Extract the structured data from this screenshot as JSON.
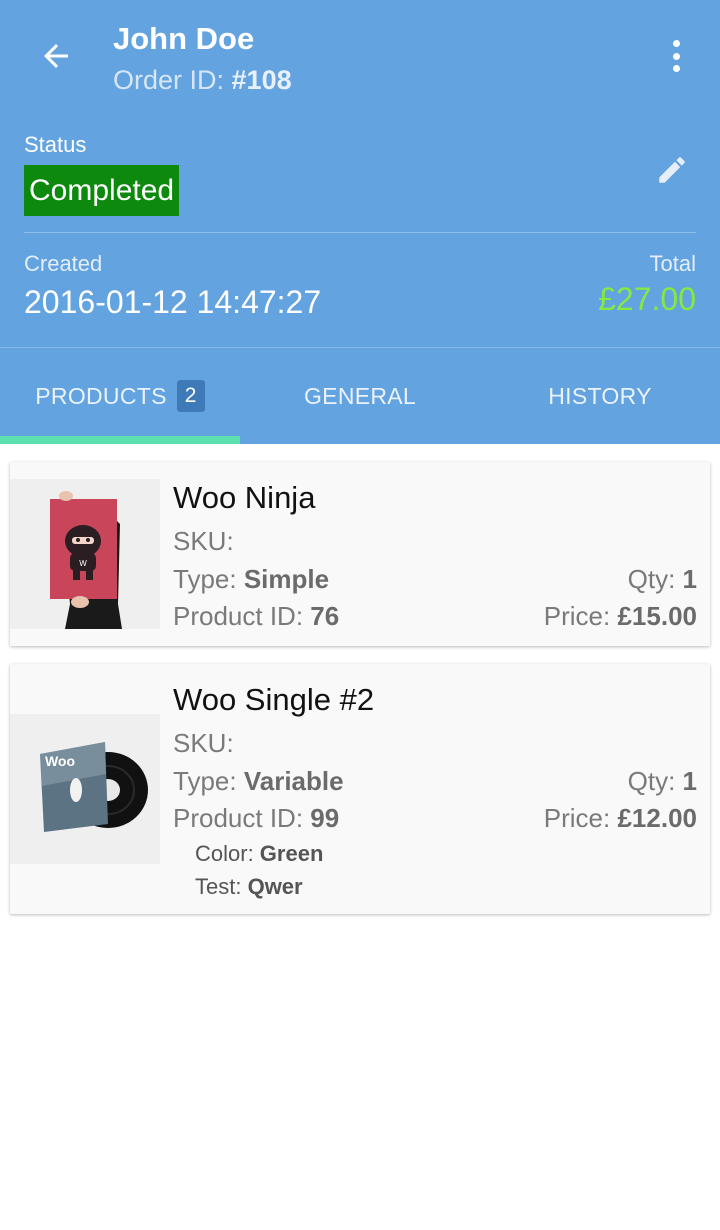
{
  "header": {
    "customer_name": "John Doe",
    "order_label": "Order ID: ",
    "order_id": "#108",
    "status_label": "Status",
    "status_value": "Completed",
    "created_label": "Created",
    "created_value": "2016-01-12 14:47:27",
    "total_label": "Total",
    "total_value": "£27.00"
  },
  "tabs": [
    {
      "label": "PRODUCTS",
      "badge": "2",
      "active": true
    },
    {
      "label": "GENERAL"
    },
    {
      "label": "HISTORY"
    }
  ],
  "products": [
    {
      "name": "Woo Ninja",
      "sku_label": "SKU:",
      "sku": "",
      "type_label": "Type: ",
      "type": "Simple",
      "qty_label": "Qty: ",
      "qty": "1",
      "id_label": "Product ID: ",
      "id": "76",
      "price_label": "Price: ",
      "price": "£15.00",
      "image_icon": "ninja-poster-image"
    },
    {
      "name": "Woo Single #2",
      "sku_label": "SKU:",
      "sku": "",
      "type_label": "Type: ",
      "type": "Variable",
      "qty_label": "Qty: ",
      "qty": "1",
      "id_label": "Product ID: ",
      "id": "99",
      "price_label": "Price: ",
      "price": "£12.00",
      "image_icon": "vinyl-record-image",
      "image_text": "Woo",
      "attributes": [
        {
          "label": "Color: ",
          "value": "Green"
        },
        {
          "label": "Test: ",
          "value": "Qwer"
        }
      ]
    }
  ],
  "colors": {
    "header_bg": "#63A3E0",
    "status_bg": "#0D8A0D",
    "total_color": "#86E843",
    "tab_indicator": "#5DE0B0"
  }
}
